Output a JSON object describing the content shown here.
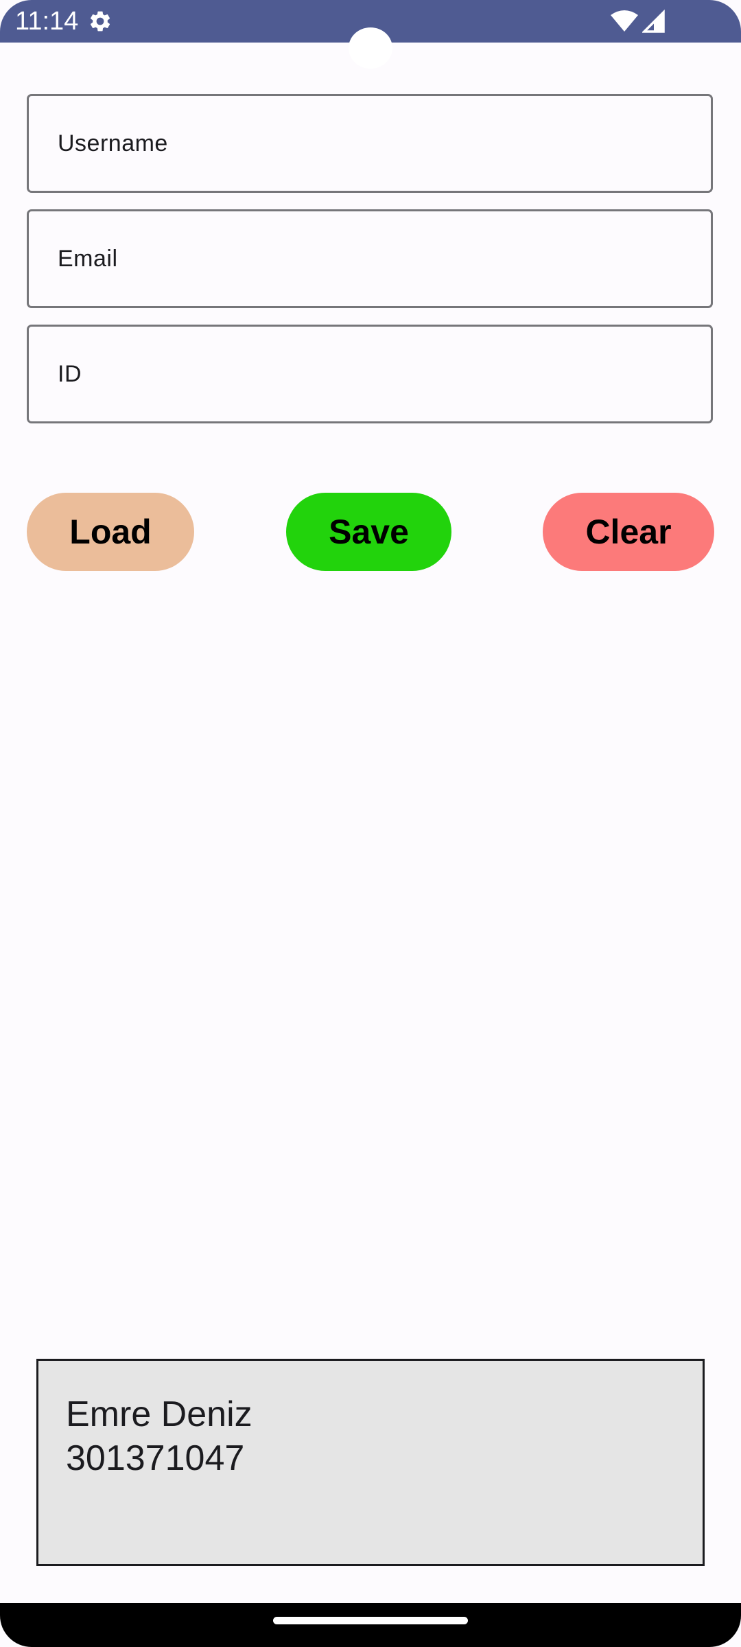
{
  "status_bar": {
    "time": "11:14",
    "background_color": "#4f5b92",
    "icons": [
      "gear-icon",
      "wifi-icon",
      "signal-icon"
    ]
  },
  "form": {
    "username_placeholder": "Username",
    "email_placeholder": "Email",
    "id_placeholder": "ID"
  },
  "buttons": {
    "load_label": "Load",
    "save_label": "Save",
    "clear_label": "Clear",
    "load_color": "#ebbd9a",
    "save_color": "#22d30c",
    "clear_color": "#fc7a7a"
  },
  "output": {
    "name": "Emre Deniz",
    "id": "301371047"
  }
}
